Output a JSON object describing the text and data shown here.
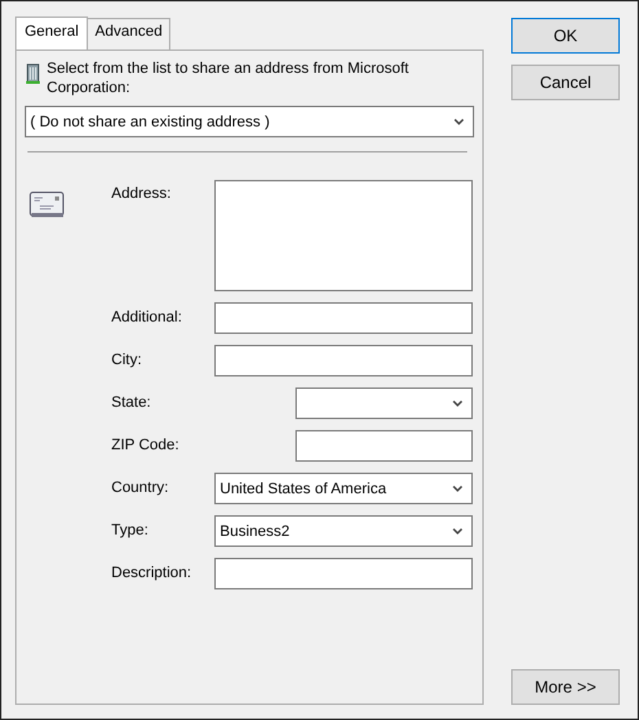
{
  "tabs": [
    {
      "label": "General",
      "selected": true
    },
    {
      "label": "Advanced",
      "selected": false
    }
  ],
  "share": {
    "prompt": "Select from the list to share an address from Microsoft Corporation:",
    "value": "( Do not share an existing address )"
  },
  "fields": [
    {
      "label": "Address:",
      "kind": "multiline",
      "short": false
    },
    {
      "label": "Additional:",
      "kind": "text",
      "short": false
    },
    {
      "label": "City:",
      "kind": "text",
      "short": false
    },
    {
      "label": "State:",
      "kind": "dropdown",
      "short": true
    },
    {
      "label": "ZIP Code:",
      "kind": "text",
      "short": true
    },
    {
      "label": "Country:",
      "kind": "dropdown",
      "short": false,
      "value": "United States of America"
    },
    {
      "label": "Type:",
      "kind": "dropdown",
      "short": false,
      "value": "Business2"
    },
    {
      "label": "Description:",
      "kind": "text",
      "short": false
    }
  ],
  "buttons": {
    "ok": "OK",
    "cancel": "Cancel",
    "more": "More >>"
  }
}
